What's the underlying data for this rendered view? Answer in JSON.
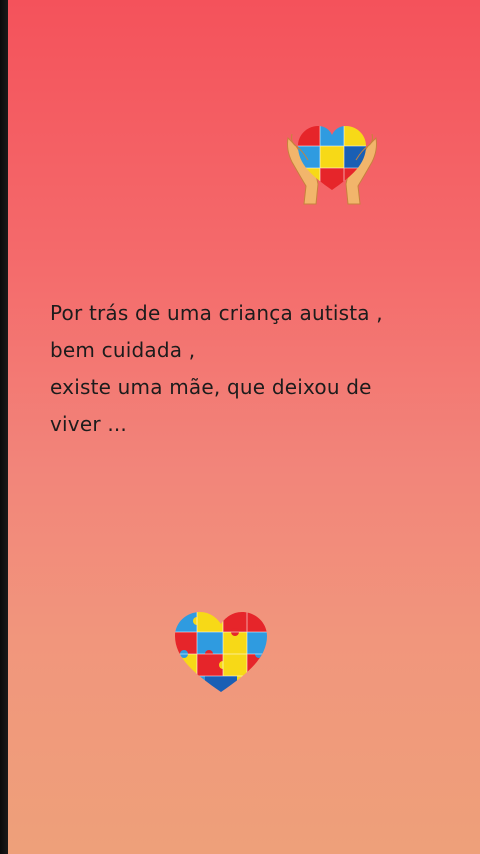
{
  "story": {
    "background_top": "#f4525b",
    "background_bottom": "#eea07a",
    "lines": [
      "Por trás de uma criança autista ,",
      "bem cuidada ,",
      "existe uma mãe, que deixou de",
      "viver ..."
    ]
  },
  "stickers": {
    "top": "hands-holding-puzzle-heart-icon",
    "bottom": "puzzle-heart-icon",
    "puzzle_colors": [
      "#e6252a",
      "#f7d917",
      "#2f9be0",
      "#1a5fb4"
    ]
  }
}
